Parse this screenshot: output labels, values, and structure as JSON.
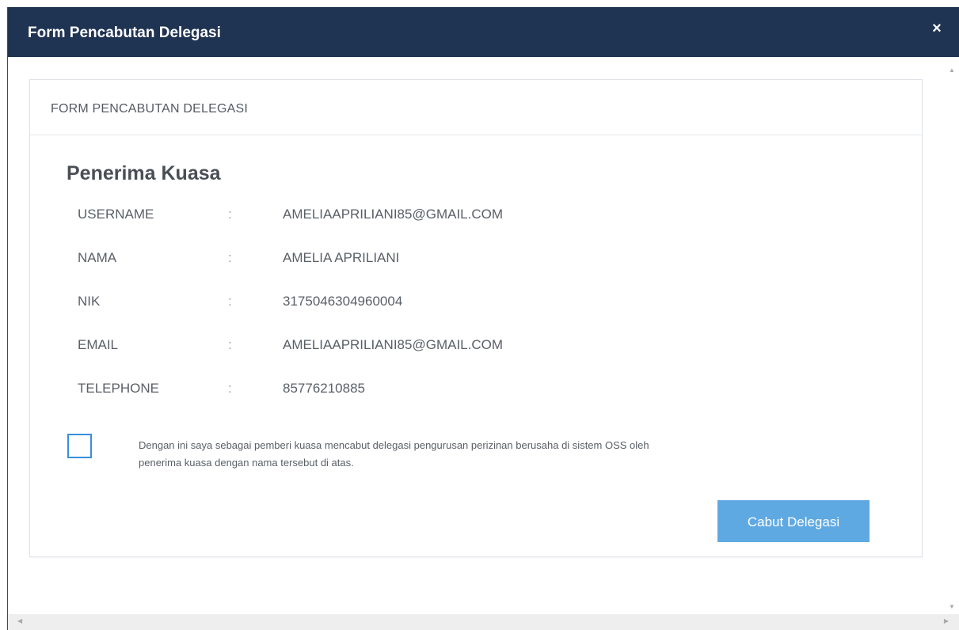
{
  "modal": {
    "title": "Form Pencabutan Delegasi",
    "close_icon": "×"
  },
  "panel": {
    "heading": "FORM PENCABUTAN DELEGASI",
    "section_title": "Penerima Kuasa",
    "separator": ":",
    "rows": [
      {
        "label": "USERNAME",
        "value": "AMELIAAPRILIANI85@GMAIL.COM"
      },
      {
        "label": "NAMA",
        "value": "AMELIA APRILIANI"
      },
      {
        "label": "NIK",
        "value": "3175046304960004"
      },
      {
        "label": "EMAIL",
        "value": "AMELIAAPRILIANI85@GMAIL.COM"
      },
      {
        "label": "TELEPHONE",
        "value": "85776210885"
      }
    ],
    "agreement_line1": "Dengan ini saya sebagai pemberi kuasa mencabut delegasi pengurusan perizinan berusaha di sistem OSS oleh",
    "agreement_line2": "penerima kuasa dengan nama tersebut di atas.",
    "agreement_checked": false,
    "submit_label": "Cabut Delegasi"
  },
  "scrollbar": {
    "up": "▲",
    "down": "▼",
    "left": "◀",
    "right": "▶"
  },
  "colors": {
    "header_bg": "#1f3352",
    "button_bg": "#5fa9e3",
    "checkbox_border": "#3a8ddd"
  }
}
